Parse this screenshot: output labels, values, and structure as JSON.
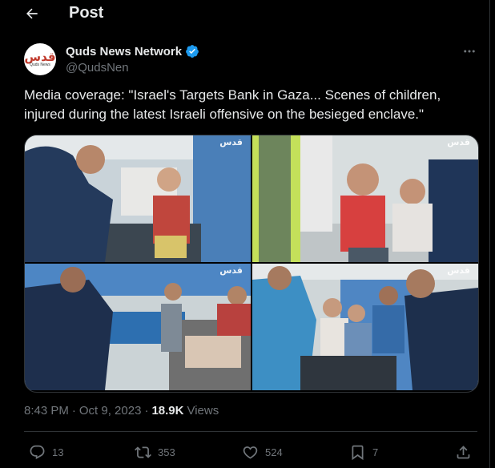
{
  "header": {
    "title": "Post"
  },
  "author": {
    "display_name": "Quds News Network",
    "handle": "@QudsNen",
    "verified": true,
    "avatar_text_ar": "قدس",
    "avatar_text_en": "Quds News"
  },
  "tweet": {
    "text": "Media coverage: \"Israel's Targets Bank in Gaza... Scenes of children, injured during the latest Israeli offensive on the besieged enclave.\""
  },
  "media": {
    "watermark": "قدس",
    "photos": [
      "photo-1",
      "photo-2",
      "photo-3",
      "photo-4"
    ]
  },
  "meta": {
    "time": "8:43 PM",
    "date": "Oct 9, 2023",
    "separator": "·",
    "views_count": "18.9K",
    "views_label": "Views"
  },
  "actions": {
    "replies": "13",
    "reposts": "353",
    "likes": "524",
    "bookmarks": "7"
  },
  "colors": {
    "background": "#000000",
    "text": "#e7e9ea",
    "muted": "#71767b",
    "border": "#2f3336",
    "verified": "#1d9bf0"
  }
}
